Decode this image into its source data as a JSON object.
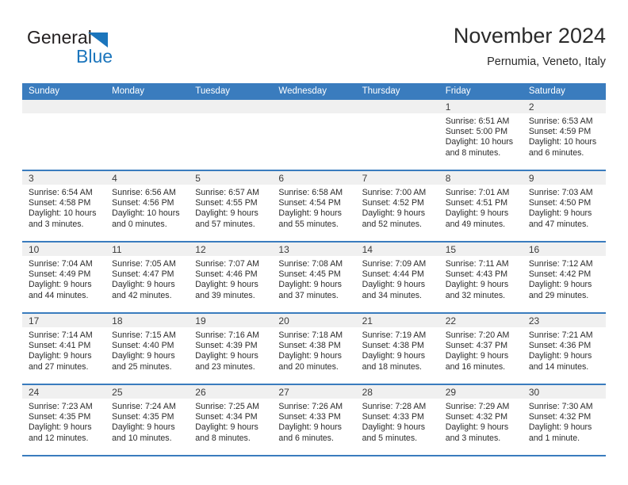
{
  "brand": {
    "word1": "General",
    "word2": "Blue",
    "triangle_color": "#1b75bc",
    "text_color": "#231f20"
  },
  "header": {
    "title": "November 2024",
    "subtitle": "Pernumia, Veneto, Italy"
  },
  "theme": {
    "header_row_bg": "#3a7cbe",
    "datebar_bg": "#f0f0f0",
    "cell_bg": "#ffffff",
    "row_border": "#3a7cbe"
  },
  "weekdays": [
    "Sunday",
    "Monday",
    "Tuesday",
    "Wednesday",
    "Thursday",
    "Friday",
    "Saturday"
  ],
  "weeks": [
    [
      {
        "day": "",
        "empty": true
      },
      {
        "day": "",
        "empty": true
      },
      {
        "day": "",
        "empty": true
      },
      {
        "day": "",
        "empty": true
      },
      {
        "day": "",
        "empty": true
      },
      {
        "day": "1",
        "sunrise": "Sunrise: 6:51 AM",
        "sunset": "Sunset: 5:00 PM",
        "daylight1": "Daylight: 10 hours",
        "daylight2": "and 8 minutes."
      },
      {
        "day": "2",
        "sunrise": "Sunrise: 6:53 AM",
        "sunset": "Sunset: 4:59 PM",
        "daylight1": "Daylight: 10 hours",
        "daylight2": "and 6 minutes."
      }
    ],
    [
      {
        "day": "3",
        "sunrise": "Sunrise: 6:54 AM",
        "sunset": "Sunset: 4:58 PM",
        "daylight1": "Daylight: 10 hours",
        "daylight2": "and 3 minutes."
      },
      {
        "day": "4",
        "sunrise": "Sunrise: 6:56 AM",
        "sunset": "Sunset: 4:56 PM",
        "daylight1": "Daylight: 10 hours",
        "daylight2": "and 0 minutes."
      },
      {
        "day": "5",
        "sunrise": "Sunrise: 6:57 AM",
        "sunset": "Sunset: 4:55 PM",
        "daylight1": "Daylight: 9 hours",
        "daylight2": "and 57 minutes."
      },
      {
        "day": "6",
        "sunrise": "Sunrise: 6:58 AM",
        "sunset": "Sunset: 4:54 PM",
        "daylight1": "Daylight: 9 hours",
        "daylight2": "and 55 minutes."
      },
      {
        "day": "7",
        "sunrise": "Sunrise: 7:00 AM",
        "sunset": "Sunset: 4:52 PM",
        "daylight1": "Daylight: 9 hours",
        "daylight2": "and 52 minutes."
      },
      {
        "day": "8",
        "sunrise": "Sunrise: 7:01 AM",
        "sunset": "Sunset: 4:51 PM",
        "daylight1": "Daylight: 9 hours",
        "daylight2": "and 49 minutes."
      },
      {
        "day": "9",
        "sunrise": "Sunrise: 7:03 AM",
        "sunset": "Sunset: 4:50 PM",
        "daylight1": "Daylight: 9 hours",
        "daylight2": "and 47 minutes."
      }
    ],
    [
      {
        "day": "10",
        "sunrise": "Sunrise: 7:04 AM",
        "sunset": "Sunset: 4:49 PM",
        "daylight1": "Daylight: 9 hours",
        "daylight2": "and 44 minutes."
      },
      {
        "day": "11",
        "sunrise": "Sunrise: 7:05 AM",
        "sunset": "Sunset: 4:47 PM",
        "daylight1": "Daylight: 9 hours",
        "daylight2": "and 42 minutes."
      },
      {
        "day": "12",
        "sunrise": "Sunrise: 7:07 AM",
        "sunset": "Sunset: 4:46 PM",
        "daylight1": "Daylight: 9 hours",
        "daylight2": "and 39 minutes."
      },
      {
        "day": "13",
        "sunrise": "Sunrise: 7:08 AM",
        "sunset": "Sunset: 4:45 PM",
        "daylight1": "Daylight: 9 hours",
        "daylight2": "and 37 minutes."
      },
      {
        "day": "14",
        "sunrise": "Sunrise: 7:09 AM",
        "sunset": "Sunset: 4:44 PM",
        "daylight1": "Daylight: 9 hours",
        "daylight2": "and 34 minutes."
      },
      {
        "day": "15",
        "sunrise": "Sunrise: 7:11 AM",
        "sunset": "Sunset: 4:43 PM",
        "daylight1": "Daylight: 9 hours",
        "daylight2": "and 32 minutes."
      },
      {
        "day": "16",
        "sunrise": "Sunrise: 7:12 AM",
        "sunset": "Sunset: 4:42 PM",
        "daylight1": "Daylight: 9 hours",
        "daylight2": "and 29 minutes."
      }
    ],
    [
      {
        "day": "17",
        "sunrise": "Sunrise: 7:14 AM",
        "sunset": "Sunset: 4:41 PM",
        "daylight1": "Daylight: 9 hours",
        "daylight2": "and 27 minutes."
      },
      {
        "day": "18",
        "sunrise": "Sunrise: 7:15 AM",
        "sunset": "Sunset: 4:40 PM",
        "daylight1": "Daylight: 9 hours",
        "daylight2": "and 25 minutes."
      },
      {
        "day": "19",
        "sunrise": "Sunrise: 7:16 AM",
        "sunset": "Sunset: 4:39 PM",
        "daylight1": "Daylight: 9 hours",
        "daylight2": "and 23 minutes."
      },
      {
        "day": "20",
        "sunrise": "Sunrise: 7:18 AM",
        "sunset": "Sunset: 4:38 PM",
        "daylight1": "Daylight: 9 hours",
        "daylight2": "and 20 minutes."
      },
      {
        "day": "21",
        "sunrise": "Sunrise: 7:19 AM",
        "sunset": "Sunset: 4:38 PM",
        "daylight1": "Daylight: 9 hours",
        "daylight2": "and 18 minutes."
      },
      {
        "day": "22",
        "sunrise": "Sunrise: 7:20 AM",
        "sunset": "Sunset: 4:37 PM",
        "daylight1": "Daylight: 9 hours",
        "daylight2": "and 16 minutes."
      },
      {
        "day": "23",
        "sunrise": "Sunrise: 7:21 AM",
        "sunset": "Sunset: 4:36 PM",
        "daylight1": "Daylight: 9 hours",
        "daylight2": "and 14 minutes."
      }
    ],
    [
      {
        "day": "24",
        "sunrise": "Sunrise: 7:23 AM",
        "sunset": "Sunset: 4:35 PM",
        "daylight1": "Daylight: 9 hours",
        "daylight2": "and 12 minutes."
      },
      {
        "day": "25",
        "sunrise": "Sunrise: 7:24 AM",
        "sunset": "Sunset: 4:35 PM",
        "daylight1": "Daylight: 9 hours",
        "daylight2": "and 10 minutes."
      },
      {
        "day": "26",
        "sunrise": "Sunrise: 7:25 AM",
        "sunset": "Sunset: 4:34 PM",
        "daylight1": "Daylight: 9 hours",
        "daylight2": "and 8 minutes."
      },
      {
        "day": "27",
        "sunrise": "Sunrise: 7:26 AM",
        "sunset": "Sunset: 4:33 PM",
        "daylight1": "Daylight: 9 hours",
        "daylight2": "and 6 minutes."
      },
      {
        "day": "28",
        "sunrise": "Sunrise: 7:28 AM",
        "sunset": "Sunset: 4:33 PM",
        "daylight1": "Daylight: 9 hours",
        "daylight2": "and 5 minutes."
      },
      {
        "day": "29",
        "sunrise": "Sunrise: 7:29 AM",
        "sunset": "Sunset: 4:32 PM",
        "daylight1": "Daylight: 9 hours",
        "daylight2": "and 3 minutes."
      },
      {
        "day": "30",
        "sunrise": "Sunrise: 7:30 AM",
        "sunset": "Sunset: 4:32 PM",
        "daylight1": "Daylight: 9 hours",
        "daylight2": "and 1 minute."
      }
    ]
  ]
}
